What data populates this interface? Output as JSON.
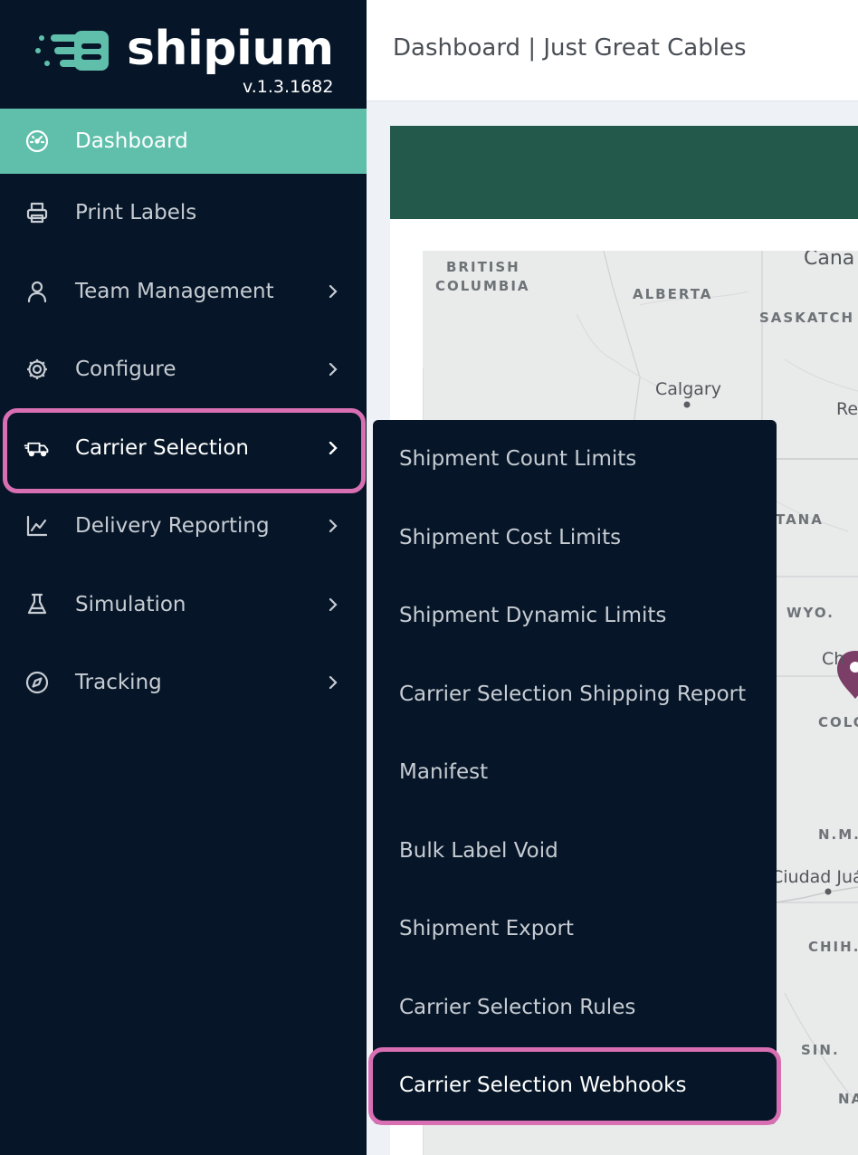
{
  "brand": {
    "name": "shipium",
    "version": "v.1.3.1682",
    "accent_color": "#5fbfab",
    "sidebar_bg": "#061628",
    "highlight_color": "#d96fb3"
  },
  "header": {
    "title": "Dashboard | Just Great Cables"
  },
  "sidebar": {
    "items": [
      {
        "label": "Dashboard",
        "icon": "speedometer-icon",
        "active": true
      },
      {
        "label": "Print Labels",
        "icon": "printer-icon"
      },
      {
        "label": "Team Management",
        "icon": "user-icon"
      },
      {
        "label": "Configure",
        "icon": "gear-icon"
      },
      {
        "label": "Carrier Selection",
        "icon": "truck-icon",
        "selected": true
      },
      {
        "label": "Delivery Reporting",
        "icon": "chart-line-icon"
      },
      {
        "label": "Simulation",
        "icon": "flask-icon"
      },
      {
        "label": "Tracking",
        "icon": "compass-icon"
      }
    ]
  },
  "submenu": {
    "items": [
      {
        "label": "Shipment Count Limits"
      },
      {
        "label": "Shipment Cost Limits"
      },
      {
        "label": "Shipment Dynamic Limits"
      },
      {
        "label": "Carrier Selection Shipping Report"
      },
      {
        "label": "Manifest"
      },
      {
        "label": "Bulk Label Void"
      },
      {
        "label": "Shipment Export"
      },
      {
        "label": "Carrier Selection Rules"
      },
      {
        "label": "Carrier Selection Webhooks"
      }
    ]
  },
  "map": {
    "labels": {
      "british_columbia_1": "BRITISH",
      "british_columbia_2": "COLUMBIA",
      "alberta": "ALBERTA",
      "saskatchewan": "SASKATCH",
      "canada": "Cana",
      "calgary": "Calgary",
      "regina": "Re",
      "montana": "TANA",
      "wyoming": "WYO.",
      "cheyenne": "Ch",
      "colorado": "COLO",
      "new_mexico": "N.M.",
      "ciudad_juarez": "Ciudad Juá",
      "chihuahua": "CHIH.",
      "sinaloa": "SIN.",
      "nayarit": "NA"
    }
  }
}
